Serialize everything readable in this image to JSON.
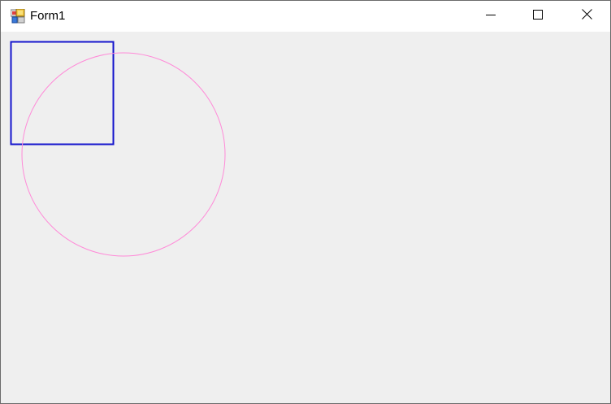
{
  "window": {
    "title": "Form1",
    "app_icon": "winforms-app-icon"
  },
  "caption_buttons": {
    "minimize_icon": "minimize-icon",
    "maximize_icon": "maximize-icon",
    "close_icon": "close-icon"
  },
  "drawing": {
    "rectangle_color": "#1414cc",
    "circle_color": "#ff8ad8"
  },
  "colors": {
    "titlebar": "#ffffff",
    "client": "#efefef"
  }
}
